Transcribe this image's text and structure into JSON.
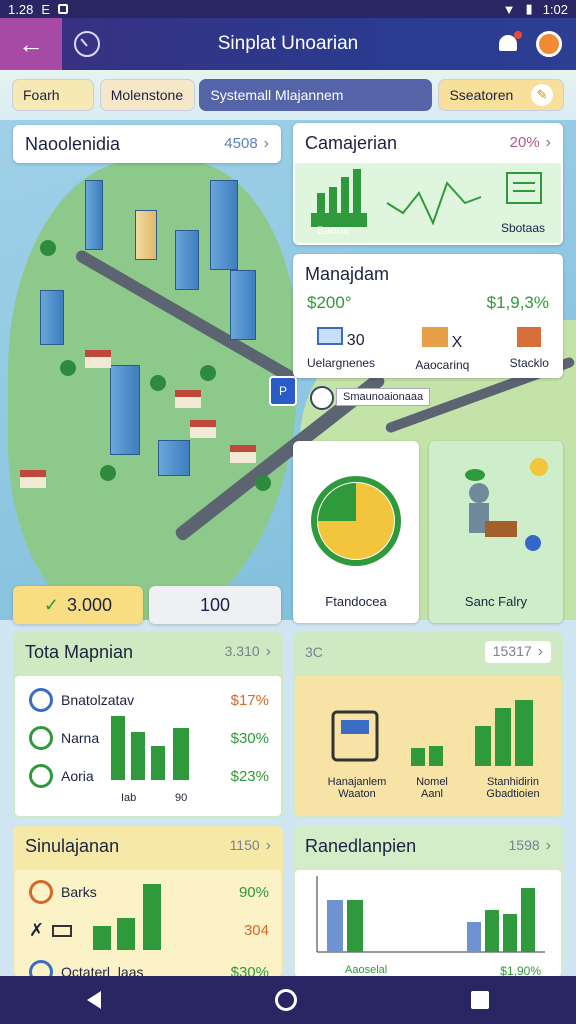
{
  "status_bar": {
    "time": "1.28",
    "mark": "E",
    "clock_right": "1:02"
  },
  "app_bar": {
    "title": "Sinplat Unoarian"
  },
  "filters": [
    "Foarh",
    "Molenstone",
    "Systemall Mlajannem",
    "Sseatoren"
  ],
  "neighborhood": {
    "title": "Naoolenidia",
    "value": "4508"
  },
  "comparison": {
    "title": "Camajerian",
    "value": "20%",
    "footer_left": "Baoua",
    "footer_right": "Sbotaas"
  },
  "management": {
    "title": "Manajdam",
    "left_value": "$200°",
    "right_value": "$1,9,3%",
    "items": [
      {
        "label": "Uelargnenes",
        "value": "30"
      },
      {
        "label": "Aaocarinq",
        "value": "X"
      },
      {
        "label": "Stacklo",
        "value": ""
      }
    ]
  },
  "map": {
    "pin_label": "Smaunoaionaaa"
  },
  "pie_card": {
    "label": "Ftandocea",
    "fraction": 0.75
  },
  "person_card": {
    "label": "Sanc Falry"
  },
  "stats": {
    "left": "3.000",
    "right": "100"
  },
  "total_panel": {
    "title": "Tota Mapnian",
    "value": "3.310",
    "rows": [
      {
        "label": "Bnatolzatav",
        "value": "$17%"
      },
      {
        "label": "Narna",
        "value": "$30%"
      },
      {
        "label": "Aoria",
        "value": "$23%"
      }
    ],
    "axis": [
      "Iab",
      "90"
    ]
  },
  "right_panel": {
    "value_left": "3C",
    "value_right": "15317",
    "labels": [
      "Hanajanlem Waaton",
      "Nomel Aanl",
      "Stanhidirin Gbadtioien"
    ]
  },
  "simulation_panel": {
    "title": "Sinulajanan",
    "value": "1150",
    "rows": [
      {
        "label": "Barks",
        "value": "90%"
      },
      {
        "label": "",
        "value": "304"
      },
      {
        "label": "Octaterl_laas",
        "value": "$30%"
      }
    ]
  },
  "renderation_panel": {
    "title": "Ranedlanpien",
    "value": "1598",
    "footer_left": "Aaoselal",
    "footer_right": "$1,90%"
  },
  "colors": {
    "accent": "#2f9a3b",
    "appbar": "#2b3a8e",
    "back_button": "#a74aa6"
  }
}
